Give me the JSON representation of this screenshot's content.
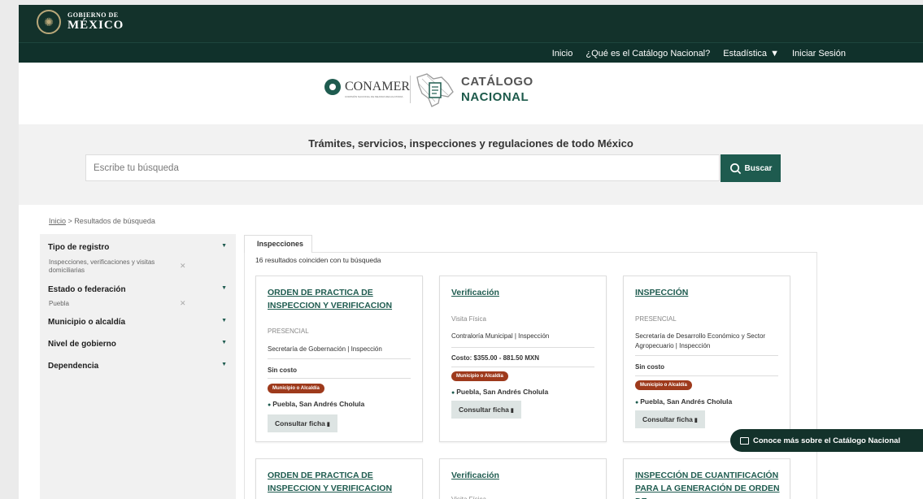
{
  "header": {
    "gov_small": "GOBIERNO DE",
    "gov_big": "MÉXICO"
  },
  "nav": {
    "items": [
      {
        "label": "Inicio"
      },
      {
        "label": "¿Qué es el Catálogo Nacional?"
      },
      {
        "label": "Estadística"
      },
      {
        "label": "Iniciar Sesión"
      }
    ]
  },
  "brand": {
    "conamer": "CONAMER",
    "conamer_sub": "COMISIÓN NACIONAL DE MEJORA REGULATORIA",
    "catalog_line1": "CATÁLOGO",
    "catalog_line2": "NACIONAL"
  },
  "search": {
    "headline": "Trámites, servicios, inspecciones y regulaciones de todo México",
    "placeholder": "Escribe tu búsqueda",
    "button_label": "Buscar"
  },
  "breadcrumb": {
    "home": "Inicio",
    "separator": ">",
    "current": "Resultados de búsqueda"
  },
  "filters": [
    {
      "title": "Tipo de registro",
      "chip": "Inspecciones, verificaciones y visitas domiciliarias"
    },
    {
      "title": "Estado o federación",
      "chip": "Puebla"
    },
    {
      "title": "Municipio o alcaldía"
    },
    {
      "title": "Nivel de gobierno"
    },
    {
      "title": "Dependencia"
    }
  ],
  "results": {
    "tab": "Inspecciones",
    "count_text": "16 resultados coinciden con tu búsqueda",
    "cards": [
      {
        "title": "ORDEN DE PRACTICA DE INSPECCION Y VERIFICACION",
        "type": "PRESENCIAL",
        "dependency": "Secretaría de Gobernación | Inspección",
        "cost": "Sin costo",
        "level": "Municipio o Alcaldía",
        "location": "Puebla, San Andrés Cholula",
        "button": "Consultar ficha"
      },
      {
        "title": "Verificación",
        "type": "Visita Física",
        "dependency": "Contraloría Municipal | Inspección",
        "cost": "Costo: $355.00 - 881.50 MXN",
        "level": "Municipio o Alcaldía",
        "location": "Puebla, San Andrés Cholula",
        "button": "Consultar ficha"
      },
      {
        "title": "INSPECCIÓN",
        "type": "PRESENCIAL",
        "dependency": "Secretaría de Desarrollo Económico y Sector Agropecuario | Inspección",
        "cost": "Sin costo",
        "level": "Municipio o Alcaldía",
        "location": "Puebla, San Andrés Cholula",
        "button": "Consultar ficha"
      },
      {
        "title": "ORDEN DE PRACTICA DE INSPECCION Y VERIFICACION",
        "type": ""
      },
      {
        "title": "Verificación",
        "type": "Visita Física"
      },
      {
        "title": "INSPECCIÓN DE CUANTIFICACIÓN PARA LA GENERACIÓN DE ORDEN DE",
        "type": ""
      }
    ]
  },
  "fab": {
    "label": "Conoce más sobre el Catálogo Nacional"
  },
  "colors": {
    "dark_green": "#13322b",
    "accent_green": "#1e5b4f",
    "badge_red": "#9e3a1c"
  }
}
